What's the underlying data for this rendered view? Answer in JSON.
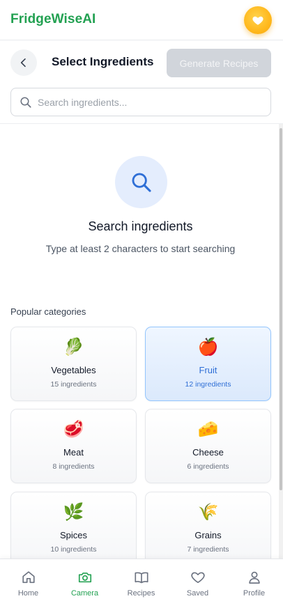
{
  "app": {
    "brand": "FridgeWiseAI"
  },
  "header": {
    "title": "Select Ingredients",
    "generate_label": "Generate Recipes"
  },
  "search": {
    "placeholder": "Search ingredients...",
    "value": ""
  },
  "empty_state": {
    "title": "Search ingredients",
    "subtitle": "Type at least 2 characters to start searching"
  },
  "categories": {
    "label": "Popular categories",
    "items": [
      {
        "emoji": "🥬",
        "name": "Vegetables",
        "count": "15 ingredients",
        "selected": false
      },
      {
        "emoji": "🍎",
        "name": "Fruit",
        "count": "12 ingredients",
        "selected": true
      },
      {
        "emoji": "🥩",
        "name": "Meat",
        "count": "8 ingredients",
        "selected": false
      },
      {
        "emoji": "🧀",
        "name": "Cheese",
        "count": "6 ingredients",
        "selected": false
      },
      {
        "emoji": "🌿",
        "name": "Spices",
        "count": "10 ingredients",
        "selected": false
      },
      {
        "emoji": "🌾",
        "name": "Grains",
        "count": "7 ingredients",
        "selected": false
      }
    ]
  },
  "nav": {
    "items": [
      {
        "label": "Home",
        "icon": "home-icon"
      },
      {
        "label": "Camera",
        "icon": "camera-icon",
        "active": true
      },
      {
        "label": "Recipes",
        "icon": "book-icon"
      },
      {
        "label": "Saved",
        "icon": "heart-icon"
      },
      {
        "label": "Profile",
        "icon": "user-icon"
      }
    ]
  },
  "colors": {
    "brand_green": "#23a152",
    "accent_yellow": "#ffb81c",
    "selected_blue": "#2f6fd6",
    "disabled_gray": "#d1d5db"
  }
}
